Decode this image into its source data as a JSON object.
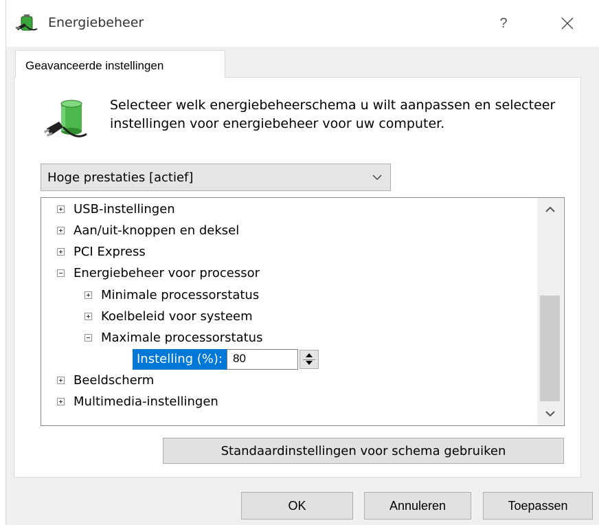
{
  "window": {
    "title": "Energiebeheer",
    "help_label": "?",
    "icon": "power-options-icon"
  },
  "tab": {
    "label": "Geavanceerde instellingen"
  },
  "description": "Selecteer welk energiebeheerschema u wilt aanpassen en selecteer instellingen voor energiebeheer voor uw computer.",
  "plan_select": {
    "value": "Hoge prestaties [actief]"
  },
  "tree": {
    "items": [
      {
        "label": "USB-instellingen",
        "state": "collapsed"
      },
      {
        "label": "Aan/uit-knoppen en deksel",
        "state": "collapsed"
      },
      {
        "label": "PCI Express",
        "state": "collapsed"
      },
      {
        "label": "Energiebeheer voor processor",
        "state": "expanded"
      },
      {
        "label": "Minimale processorstatus",
        "state": "collapsed"
      },
      {
        "label": "Koelbeleid voor systeem",
        "state": "collapsed"
      },
      {
        "label": "Maximale processorstatus",
        "state": "expanded"
      },
      {
        "label": "Beeldscherm",
        "state": "collapsed"
      },
      {
        "label": "Multimedia-instellingen",
        "state": "collapsed"
      }
    ],
    "setting": {
      "label": "Instelling (%):",
      "value": "80"
    }
  },
  "buttons": {
    "defaults": "Standaardinstellingen voor schema gebruiken",
    "ok": "OK",
    "cancel": "Annuleren",
    "apply": "Toepassen"
  },
  "colors": {
    "accent": "#0078d7",
    "dialog_bg": "#f0f0f0",
    "button_bg": "#e1e1e1"
  }
}
